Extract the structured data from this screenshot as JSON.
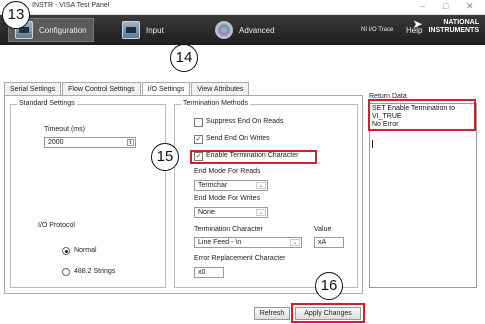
{
  "window": {
    "title": "INSTR - VISA Test Panel",
    "controls": [
      "–",
      "□",
      "✕"
    ]
  },
  "toolbar": {
    "configuration": "Configuration",
    "input": "Input",
    "advanced": "Advanced",
    "ni_io_trace": "NI I/O Trace",
    "help": "Help",
    "logo_line1": "NATIONAL",
    "logo_line2": "INSTRUMENTS"
  },
  "tabs": [
    "Serial Settings",
    "Flow Control Settings",
    "I/O Settings",
    "View Attributes"
  ],
  "standard_settings": {
    "title": "Standard Settings",
    "timeout_label": "Timeout (ms)",
    "timeout_value": "2000",
    "io_protocol_label": "I/O Protocol",
    "protocol_options": [
      "Normal",
      "488.2 Strings"
    ],
    "selected_protocol": "Normal"
  },
  "termination": {
    "title": "Termination Methods",
    "suppress_end_on_reads": "Suppress End On Reads",
    "send_end_on_writes": "Send End On Writes",
    "enable_termination_character": "Enable Termination Character",
    "suppress_checked": false,
    "send_end_checked": true,
    "enable_term_checked": true,
    "end_mode_reads_label": "End Mode For Reads",
    "end_mode_reads_value": "Termchar",
    "end_mode_writes_label": "End Mode For Writes",
    "end_mode_writes_value": "None",
    "term_char_label": "Termination Character",
    "term_char_value": "Line Feed - \\n",
    "value_label": "Value",
    "value_value": "xA",
    "error_replacement_label": "Error Replacement Character",
    "error_replacement_value": "x0"
  },
  "buttons": {
    "refresh": "Refresh",
    "apply_changes": "Apply Changes"
  },
  "return_data": {
    "label": "Return Data",
    "text": "SET Enable Termination to\nVI_TRUE\nNo Error"
  },
  "callouts": [
    "13",
    "14",
    "15",
    "16"
  ]
}
